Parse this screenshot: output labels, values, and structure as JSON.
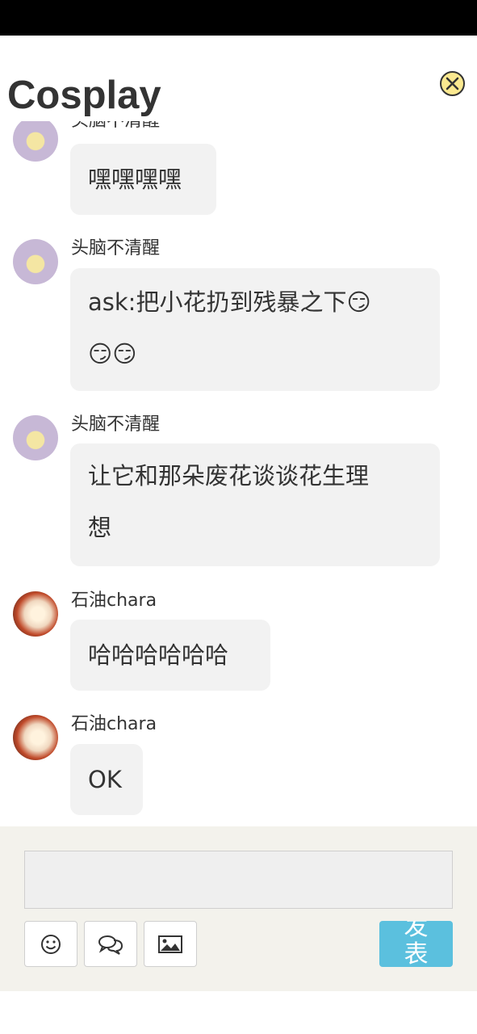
{
  "header": {
    "title": "Cosplay"
  },
  "messages": [
    {
      "user": "头脑不清醒",
      "avatar": "flowey",
      "text": "嘿嘿嘿嘿"
    },
    {
      "user": "头脑不清醒",
      "avatar": "flowey",
      "text_line1": "ask:把小花扔到残暴之下",
      "emoji": "😏",
      "line2_emojis": "😏😏"
    },
    {
      "user": "头脑不清醒",
      "avatar": "flowey",
      "text_line1": "让它和那朵废花谈谈花生理",
      "text_line2": "想"
    },
    {
      "user": "石油chara",
      "avatar": "chara",
      "text": "哈哈哈哈哈哈"
    },
    {
      "user": "石油chara",
      "avatar": "chara",
      "text": "OK"
    }
  ],
  "composer": {
    "input_value": "",
    "send_label": "发表",
    "tools": [
      "emoji-icon",
      "chat-bubbles-icon",
      "image-icon"
    ]
  }
}
